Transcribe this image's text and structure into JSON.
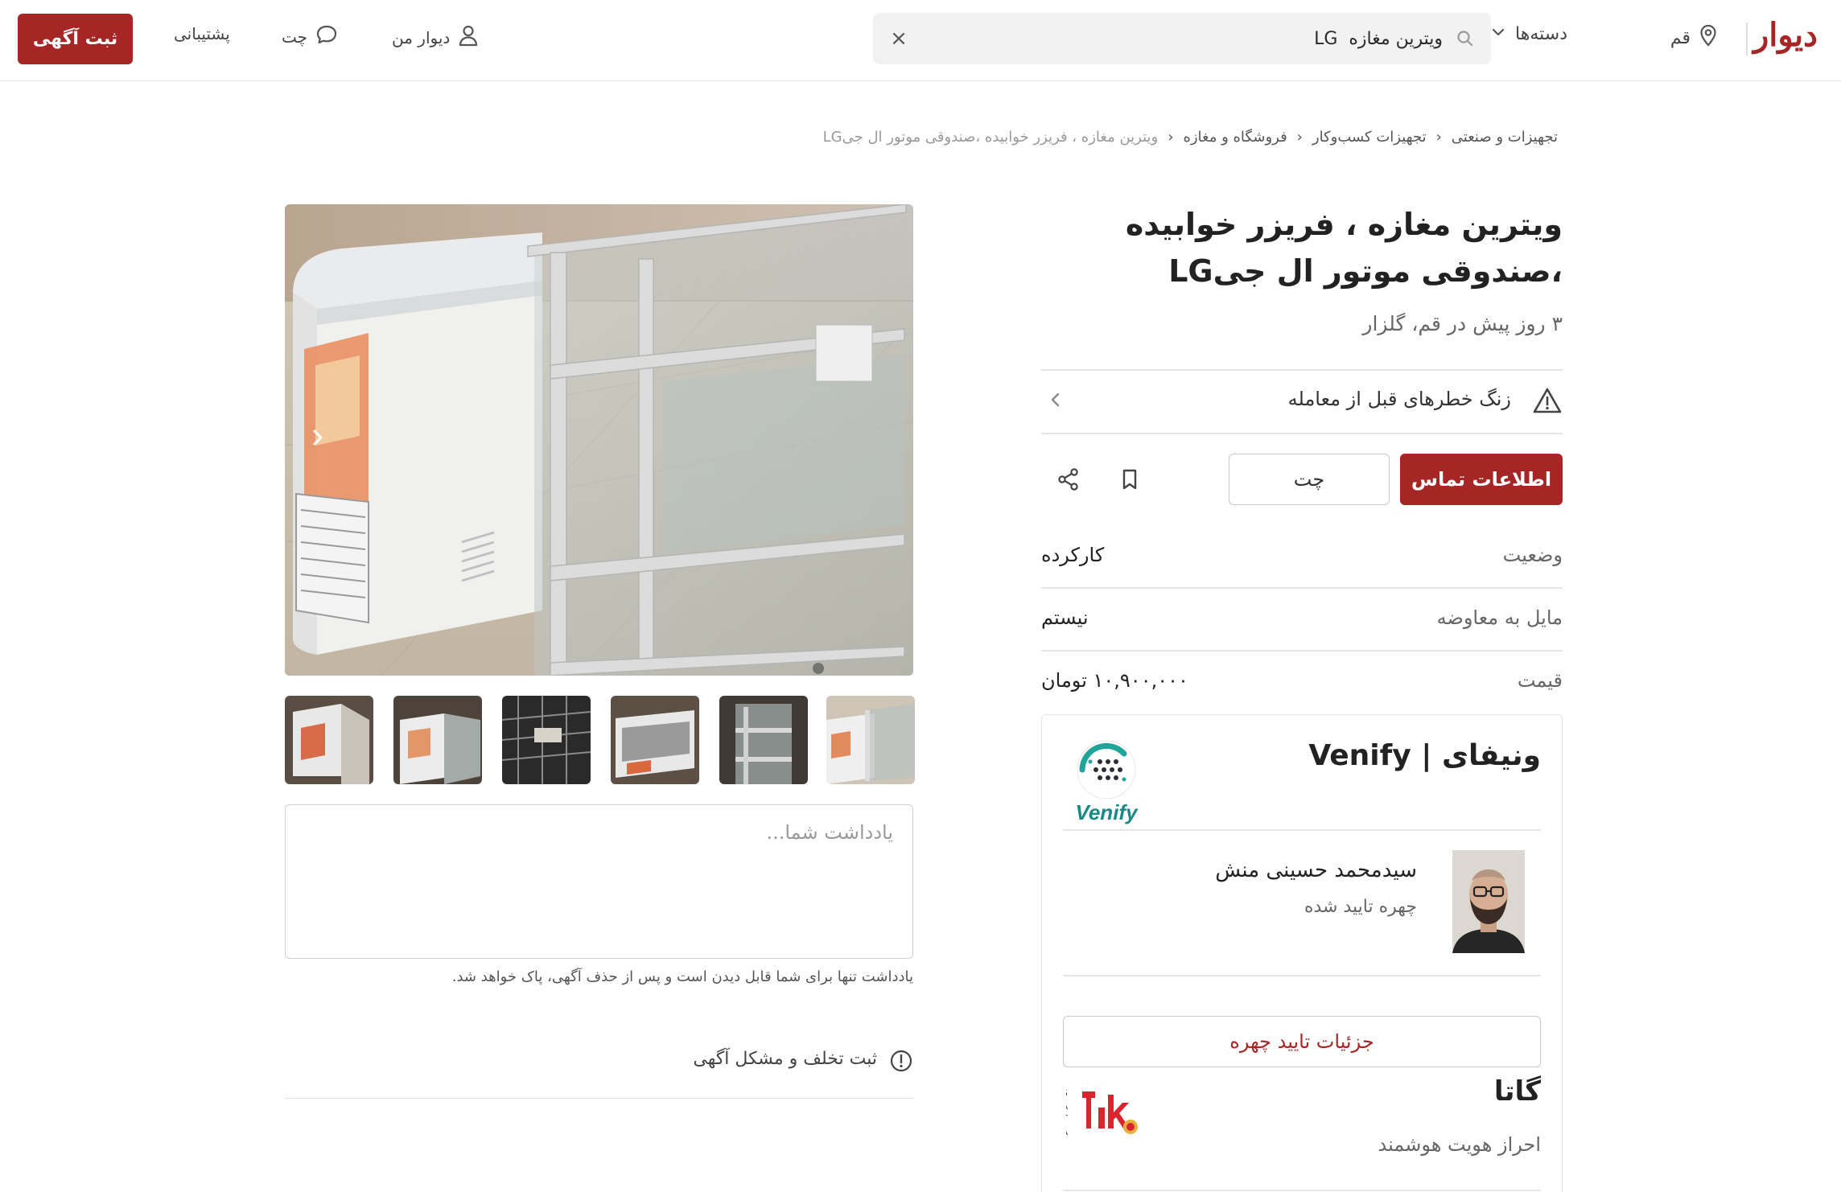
{
  "header": {
    "logo": "دیوار",
    "city": "قم",
    "categories_label": "دسته‌ها",
    "search_value": "ویترین مغازه  LG",
    "search_clear": "×",
    "nav_my_divar": "دیوار من",
    "nav_chat": "چت",
    "nav_support": "پشتیبانی",
    "post_button": "ثبت آگهی"
  },
  "breadcrumb": {
    "items": [
      "تجهیزات و صنعتی",
      "تجهیزات کسب‌وکار",
      "فروشگاه و مغازه",
      "ویترین مغازه ، فریزر خوابیده ،صندوقی موتور ال جیLG"
    ]
  },
  "ad": {
    "title": "ویترین مغازه ، فریزر خوابیده ،صندوقی موتور ال جیLG",
    "subtitle": "۳ روز پیش در قم، گلزار",
    "warning": "زنگ خطرهای قبل از معامله",
    "contact_button": "اطلاعات تماس",
    "chat_button": "چت",
    "info": [
      {
        "key": "وضعیت",
        "value": "کارکرده"
      },
      {
        "key": "مایل به معاوضه",
        "value": "نیستم"
      },
      {
        "key": "قیمت",
        "value": "۱۰,۹۰۰,۰۰۰ تومان"
      }
    ]
  },
  "verification": {
    "title": "ونیفای | Venify",
    "venify_logo_text": "Venify",
    "person_name": "سیدمحمد حسینی منش",
    "person_status": "چهره تایید شده",
    "details_button": "جزئیات تایید چهره",
    "gata_title": "گاتا",
    "gata_subtitle": "احراز هویت هوشمند"
  },
  "gallery": {
    "thumbnail_count": 6,
    "note_placeholder": "یادداشت شما...",
    "note_hint": "یادداشت تنها برای شما قابل دیدن است و پس از حذف آگهی، پاک خواهد شد.",
    "report_label": "ثبت تخلف و مشکل آگهی"
  },
  "colors": {
    "brand": "#a62626",
    "text": "#2b2b2b",
    "muted": "#666666",
    "border": "#e6e6e6"
  },
  "icons": {
    "city": "map-pin-icon",
    "categories": "chevron-down-icon",
    "search": "search-icon",
    "my_divar": "user-icon",
    "chat": "chat-bubble-icon",
    "warning": "warning-triangle-icon",
    "bookmark": "bookmark-icon",
    "share": "share-icon",
    "report": "info-circle-icon"
  }
}
